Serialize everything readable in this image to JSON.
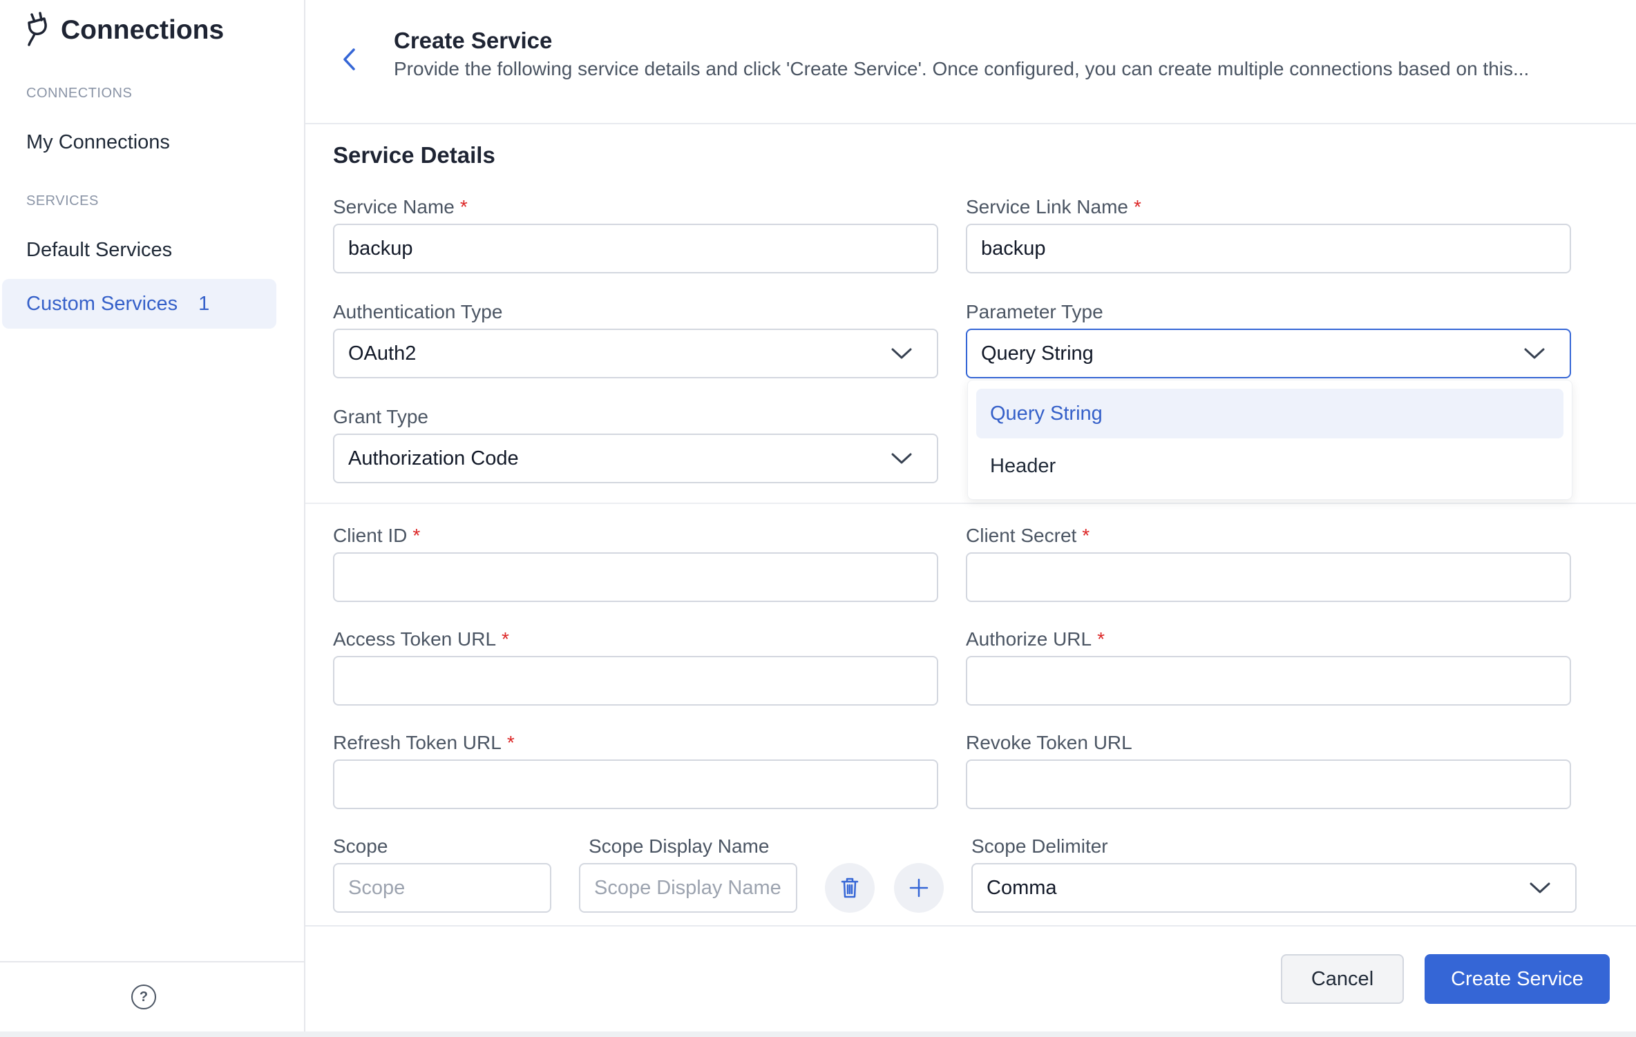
{
  "sidebar": {
    "app_title": "Connections",
    "sections": [
      {
        "label": "CONNECTIONS",
        "items": [
          {
            "label": "My Connections"
          }
        ]
      },
      {
        "label": "SERVICES",
        "items": [
          {
            "label": "Default Services"
          },
          {
            "label": "Custom Services",
            "count": "1",
            "active": true
          }
        ]
      }
    ],
    "help_glyph": "?"
  },
  "header": {
    "title": "Create Service",
    "subtitle": "Provide the following service details and click 'Create Service'. Once configured, you can create multiple connections based on this..."
  },
  "form": {
    "section_title": "Service Details",
    "service_name": {
      "label": "Service Name",
      "value": "backup"
    },
    "service_link_name": {
      "label": "Service Link Name",
      "value": "backup"
    },
    "authentication_type": {
      "label": "Authentication Type",
      "value": "OAuth2"
    },
    "parameter_type": {
      "label": "Parameter Type",
      "value": "Query String",
      "options": [
        "Query String",
        "Header"
      ]
    },
    "grant_type": {
      "label": "Grant Type",
      "value": "Authorization Code"
    },
    "client_id": {
      "label": "Client ID",
      "value": ""
    },
    "client_secret": {
      "label": "Client Secret",
      "value": ""
    },
    "access_token_url": {
      "label": "Access Token URL",
      "value": ""
    },
    "authorize_url": {
      "label": "Authorize URL",
      "value": ""
    },
    "refresh_token_url": {
      "label": "Refresh Token URL",
      "value": ""
    },
    "revoke_token_url": {
      "label": "Revoke Token URL",
      "value": ""
    },
    "scope": {
      "label": "Scope",
      "placeholder": "Scope"
    },
    "scope_display_name": {
      "label": "Scope Display Name",
      "placeholder": "Scope Display Name"
    },
    "scope_delimiter": {
      "label": "Scope Delimiter",
      "value": "Comma"
    },
    "required_mark": "*"
  },
  "footer": {
    "cancel_label": "Cancel",
    "create_label": "Create Service"
  },
  "colors": {
    "accent": "#3566d6",
    "required": "#dc2626",
    "active_bg": "#eef2fb"
  }
}
